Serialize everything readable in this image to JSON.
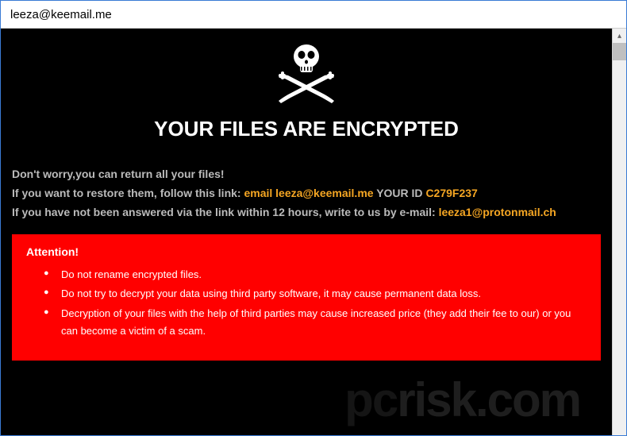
{
  "window": {
    "title": "leeza@keemail.me"
  },
  "content": {
    "headline": "YOUR FILES ARE ENCRYPTED",
    "line1": "Don't worry,you can return all your files!",
    "line2_prefix": "If you want to restore them, follow this link: ",
    "line2_email_label": "email leeza@keemail.me",
    "line2_yourid_label": "  YOUR ID ",
    "line2_id": "C279F237",
    "line3_prefix": "If you have not been answered via the link within 12 hours, write to us by e-mail: ",
    "line3_email": "leeza1@protonmail.ch"
  },
  "attention": {
    "title": "Attention!",
    "items": [
      "Do not rename encrypted files.",
      "Do not try to decrypt your data using third party software, it may cause permanent data loss.",
      "Decryption of your files with the help of third parties may cause increased price (they add their fee to our) or you can become a victim of a scam."
    ]
  },
  "watermark": {
    "text_prefix": "pc",
    "text_suffix": "risk.com"
  }
}
